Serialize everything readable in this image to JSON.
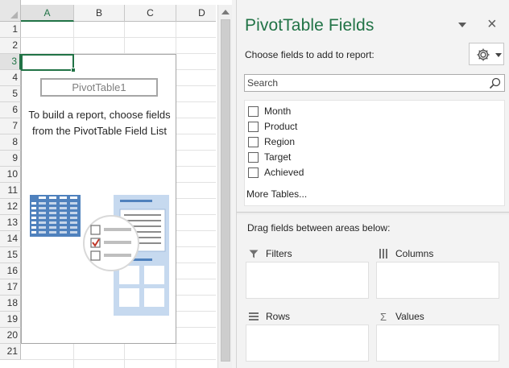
{
  "sheet": {
    "columns": [
      "A",
      "B",
      "C",
      "D"
    ],
    "rows": [
      "1",
      "2",
      "3",
      "4",
      "5",
      "6",
      "7",
      "8",
      "9",
      "10",
      "11",
      "12",
      "13",
      "14",
      "15",
      "16",
      "17",
      "18",
      "19",
      "20",
      "21"
    ],
    "selected_column": "A",
    "selected_row": "3"
  },
  "pivot_placeholder": {
    "name": "PivotTable1",
    "message": "To build a report, choose fields from the PivotTable Field List"
  },
  "pane": {
    "title": "PivotTable Fields",
    "choose_label": "Choose fields to add to report:",
    "search_placeholder": "Search",
    "fields": [
      {
        "label": "Month",
        "checked": false
      },
      {
        "label": "Product",
        "checked": false
      },
      {
        "label": "Region",
        "checked": false
      },
      {
        "label": "Target",
        "checked": false
      },
      {
        "label": "Achieved",
        "checked": false
      }
    ],
    "more_tables": "More Tables...",
    "drag_label": "Drag fields between areas below:",
    "areas": {
      "filters": "Filters",
      "columns": "Columns",
      "rows": "Rows",
      "values": "Values"
    }
  },
  "colors": {
    "accent": "#217346",
    "pane_bg": "#f3f3f3",
    "placeholder_art": "#4f81bd"
  },
  "icons": [
    "gear-icon",
    "search-icon",
    "close-icon",
    "filter-icon",
    "columns-icon",
    "rows-icon",
    "sigma-icon"
  ]
}
